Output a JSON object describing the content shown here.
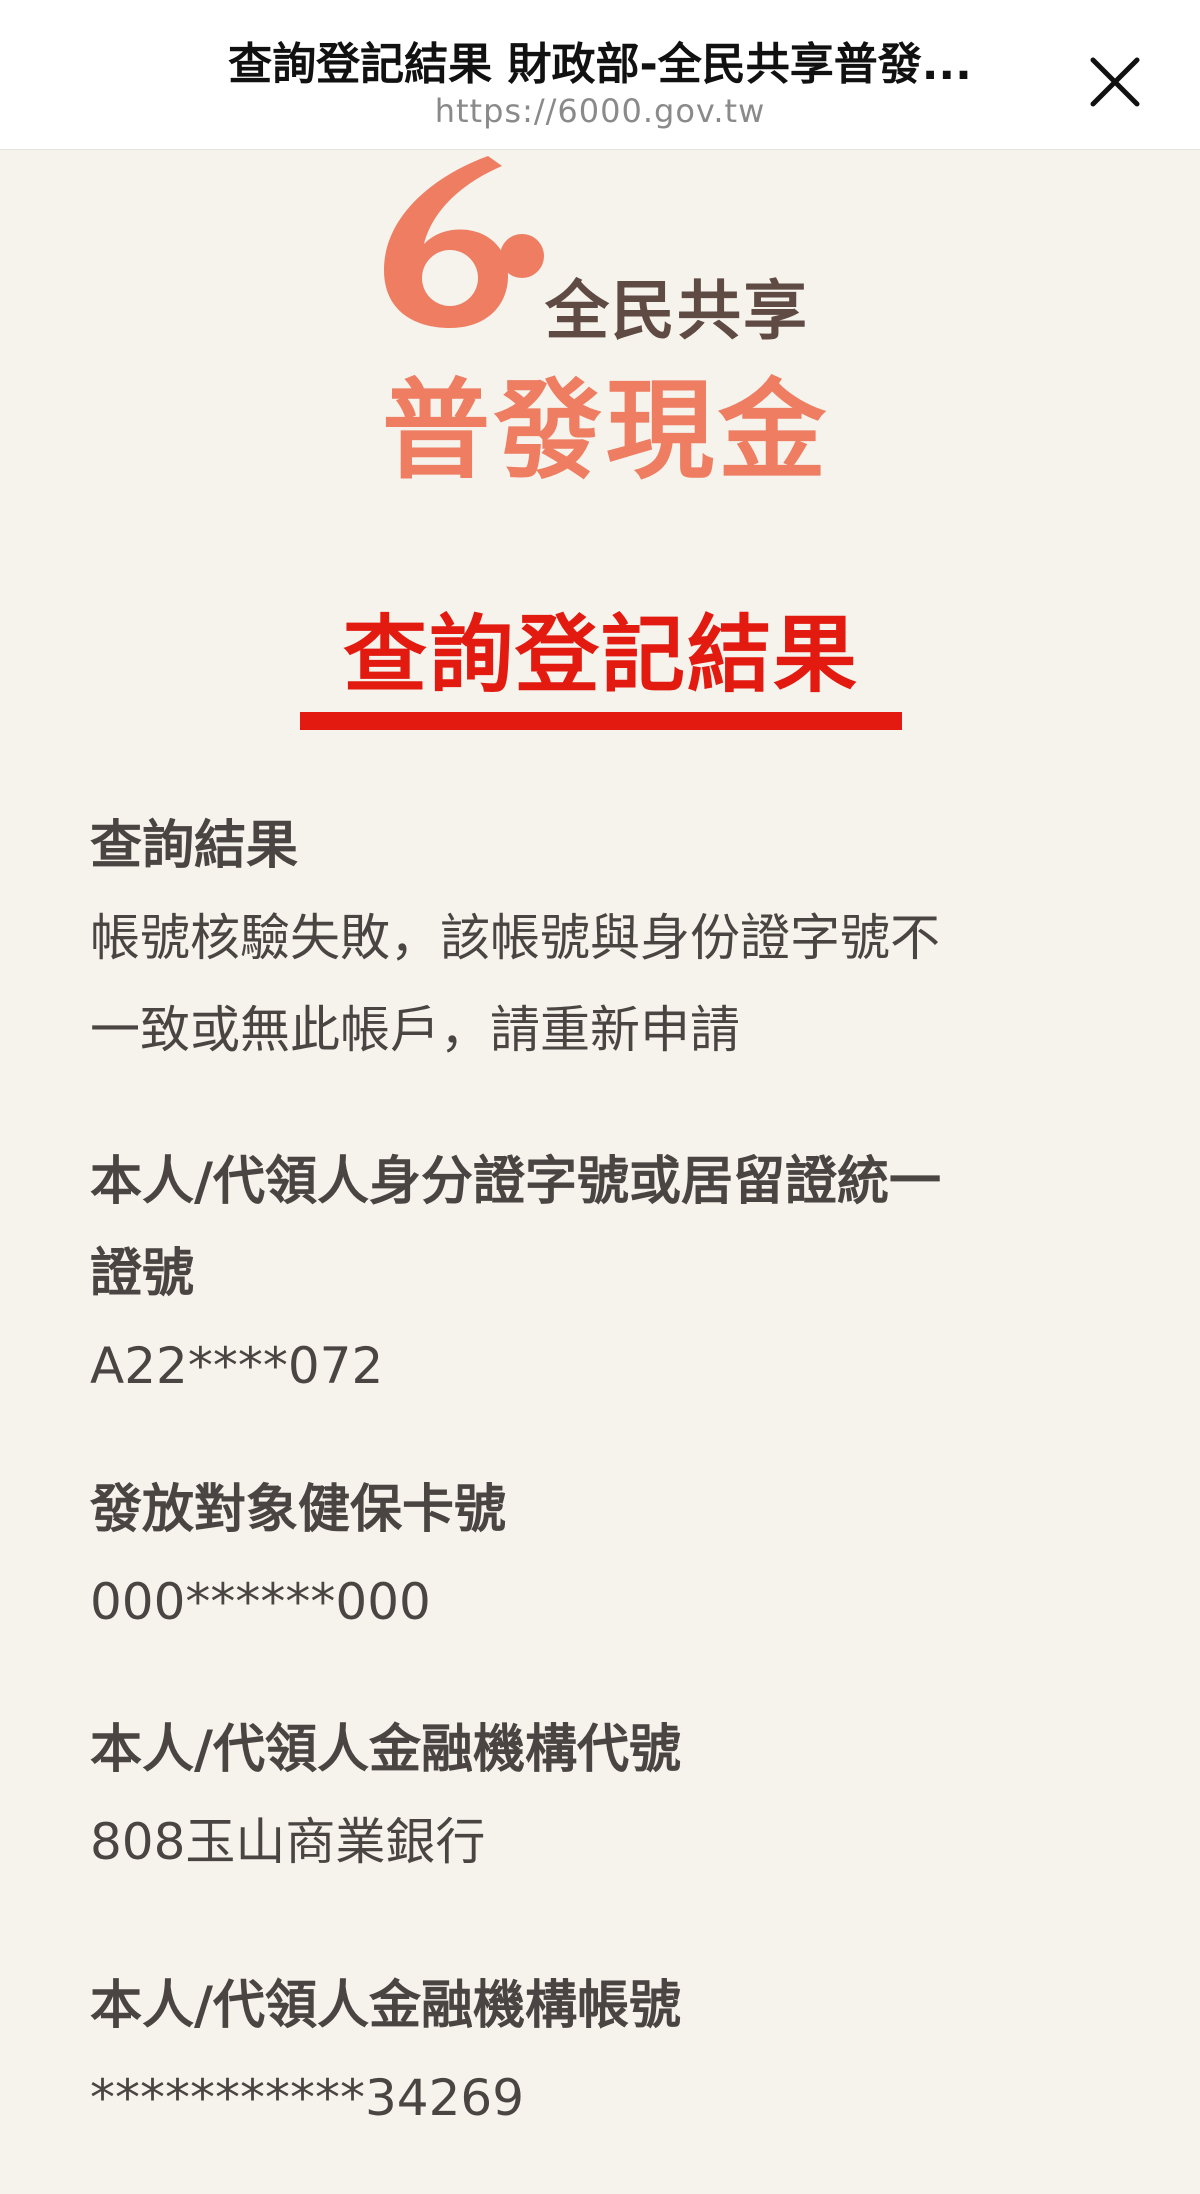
{
  "browser": {
    "title": "查詢登記結果 財政部-全民共享普發...",
    "url": "https://6000.gov.tw"
  },
  "logo": {
    "digit": "6",
    "subtitle": "全民共享",
    "title": "普發現金"
  },
  "page": {
    "heading": "查詢登記結果"
  },
  "fields": [
    {
      "label": "查詢結果",
      "value_lines": [
        "帳號核驗失敗，該帳號與身份證字號不",
        "一致或無此帳戶，請重新申請"
      ]
    },
    {
      "label_lines": [
        "本人/代領人身分證字號或居留證統一",
        "證號"
      ],
      "value": "A22****072"
    },
    {
      "label": "發放對象健保卡號",
      "value": "000******000"
    },
    {
      "label": "本人/代領人金融機構代號",
      "value": "808玉山商業銀行"
    },
    {
      "label": "本人/代領人金融機構帳號",
      "value": "***********34269"
    }
  ],
  "colors": {
    "accent_red": "#e21a10",
    "logo_orange": "#ee7d62",
    "logo_brown": "#5f4a44",
    "background": "#f5f3ec"
  },
  "icons": {
    "close": "close-icon"
  }
}
